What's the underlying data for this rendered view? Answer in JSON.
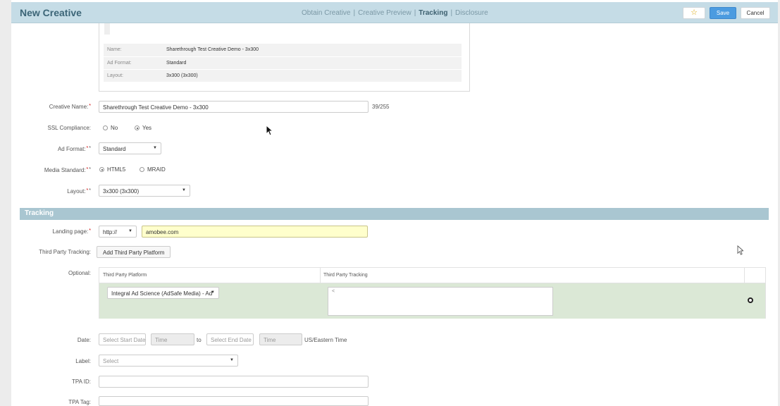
{
  "header": {
    "title": "New Creative",
    "steps": [
      "Obtain Creative",
      "Creative Preview",
      "Tracking",
      "Disclosure"
    ],
    "separator": "|",
    "active_step": "Tracking",
    "star_icon": "☆",
    "save_label": "Save",
    "cancel_label": "Cancel"
  },
  "summary": {
    "rows": [
      {
        "key": "Name:",
        "value": "Sharethrough Test Creative Demo - 3x300"
      },
      {
        "key": "Ad Format:",
        "value": "Standard"
      },
      {
        "key": "Layout:",
        "value": "3x300 (3x300)"
      }
    ]
  },
  "form": {
    "creative_name": {
      "label": "Creative Name:",
      "value": "Sharethrough Test Creative Demo - 3x300",
      "counter": "39/255"
    },
    "ssl": {
      "label": "SSL Compliance:",
      "options": [
        "No",
        "Yes"
      ],
      "selected": "Yes"
    },
    "ad_format": {
      "label": "Ad Format:",
      "value": "Standard"
    },
    "media_standard": {
      "label": "Media Standard:",
      "options": [
        "HTML5",
        "MRAID"
      ],
      "selected": "HTML5"
    },
    "layout": {
      "label": "Layout:",
      "value": "3x300 (3x300)"
    },
    "required_mark": "*",
    "info_mark": "*"
  },
  "tracking": {
    "section_title": "Tracking",
    "landing_page": {
      "label": "Landing page:",
      "protocol": "http://",
      "url": "amobee.com"
    },
    "third_party": {
      "label": "Third Party Tracking:",
      "button": "Add Third Party Platform"
    },
    "optional": {
      "label": "Optional:",
      "columns": [
        "Third Party Platform",
        "Third Party Tracking"
      ],
      "platform_value": "Integral Ad Science (AdSafe Media) - Ad",
      "tracking_value": "<"
    },
    "date": {
      "label": "Date:",
      "start_placeholder": "Select Start Date",
      "time_placeholder": "Time",
      "to": "to",
      "end_placeholder": "Select End Date",
      "timezone": "US/Eastern Time"
    },
    "label_field": {
      "label": "Label:",
      "placeholder": "Select"
    },
    "tpa_id": {
      "label": "TPA ID:",
      "value": ""
    },
    "tpa_tag": {
      "label": "TPA Tag:",
      "value": ""
    }
  },
  "colors": {
    "header_bg": "#c5dce6",
    "section_bg": "#a9c6d1",
    "save_blue": "#4b9be0",
    "row_green": "#dbe8d6"
  }
}
